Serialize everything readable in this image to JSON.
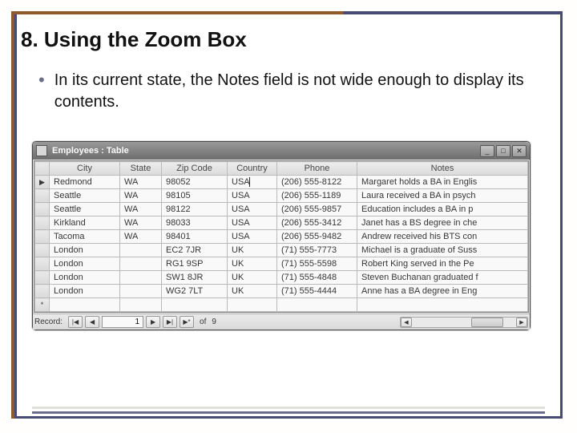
{
  "slide": {
    "title": "8. Using the Zoom Box",
    "bullet": "In its current state, the Notes field is not wide enough to display its contents."
  },
  "window": {
    "title": "Employees : Table",
    "columns": [
      "City",
      "State",
      "Zip Code",
      "Country",
      "Phone",
      "Notes"
    ],
    "rows": [
      {
        "selector": "▶",
        "city": "Redmond",
        "state": "WA",
        "zip": "98052",
        "country": "USA",
        "phone": "(206) 555-8122",
        "notes": "Margaret holds a BA in Englis"
      },
      {
        "selector": "",
        "city": "Seattle",
        "state": "WA",
        "zip": "98105",
        "country": "USA",
        "phone": "(206) 555-1189",
        "notes": "Laura received a BA in psych"
      },
      {
        "selector": "",
        "city": "Seattle",
        "state": "WA",
        "zip": "98122",
        "country": "USA",
        "phone": "(206) 555-9857",
        "notes": "Education includes a BA in p"
      },
      {
        "selector": "",
        "city": "Kirkland",
        "state": "WA",
        "zip": "98033",
        "country": "USA",
        "phone": "(206) 555-3412",
        "notes": "Janet has a BS degree in che"
      },
      {
        "selector": "",
        "city": "Tacoma",
        "state": "WA",
        "zip": "98401",
        "country": "USA",
        "phone": "(206) 555-9482",
        "notes": "Andrew received his BTS con"
      },
      {
        "selector": "",
        "city": "London",
        "state": "",
        "zip": "EC2 7JR",
        "country": "UK",
        "phone": "(71) 555-7773",
        "notes": "Michael is a graduate of Suss"
      },
      {
        "selector": "",
        "city": "London",
        "state": "",
        "zip": "RG1 9SP",
        "country": "UK",
        "phone": "(71) 555-5598",
        "notes": "Robert King served in the Pe"
      },
      {
        "selector": "",
        "city": "London",
        "state": "",
        "zip": "SW1 8JR",
        "country": "UK",
        "phone": "(71) 555-4848",
        "notes": "Steven Buchanan graduated f"
      },
      {
        "selector": "",
        "city": "London",
        "state": "",
        "zip": "WG2 7LT",
        "country": "UK",
        "phone": "(71) 555-4444",
        "notes": "Anne has a BA degree in Eng"
      }
    ],
    "new_row_marker": "*",
    "cursor_col": "country",
    "nav": {
      "label": "Record:",
      "current": "1",
      "of_label": "of",
      "total": "9"
    },
    "icons": {
      "first": "|◀",
      "prev": "◀",
      "next": "▶",
      "last": "▶|",
      "new": "▶*",
      "left": "◀",
      "right": "▶",
      "minimize": "_",
      "maximize": "□",
      "close": "✕"
    }
  }
}
